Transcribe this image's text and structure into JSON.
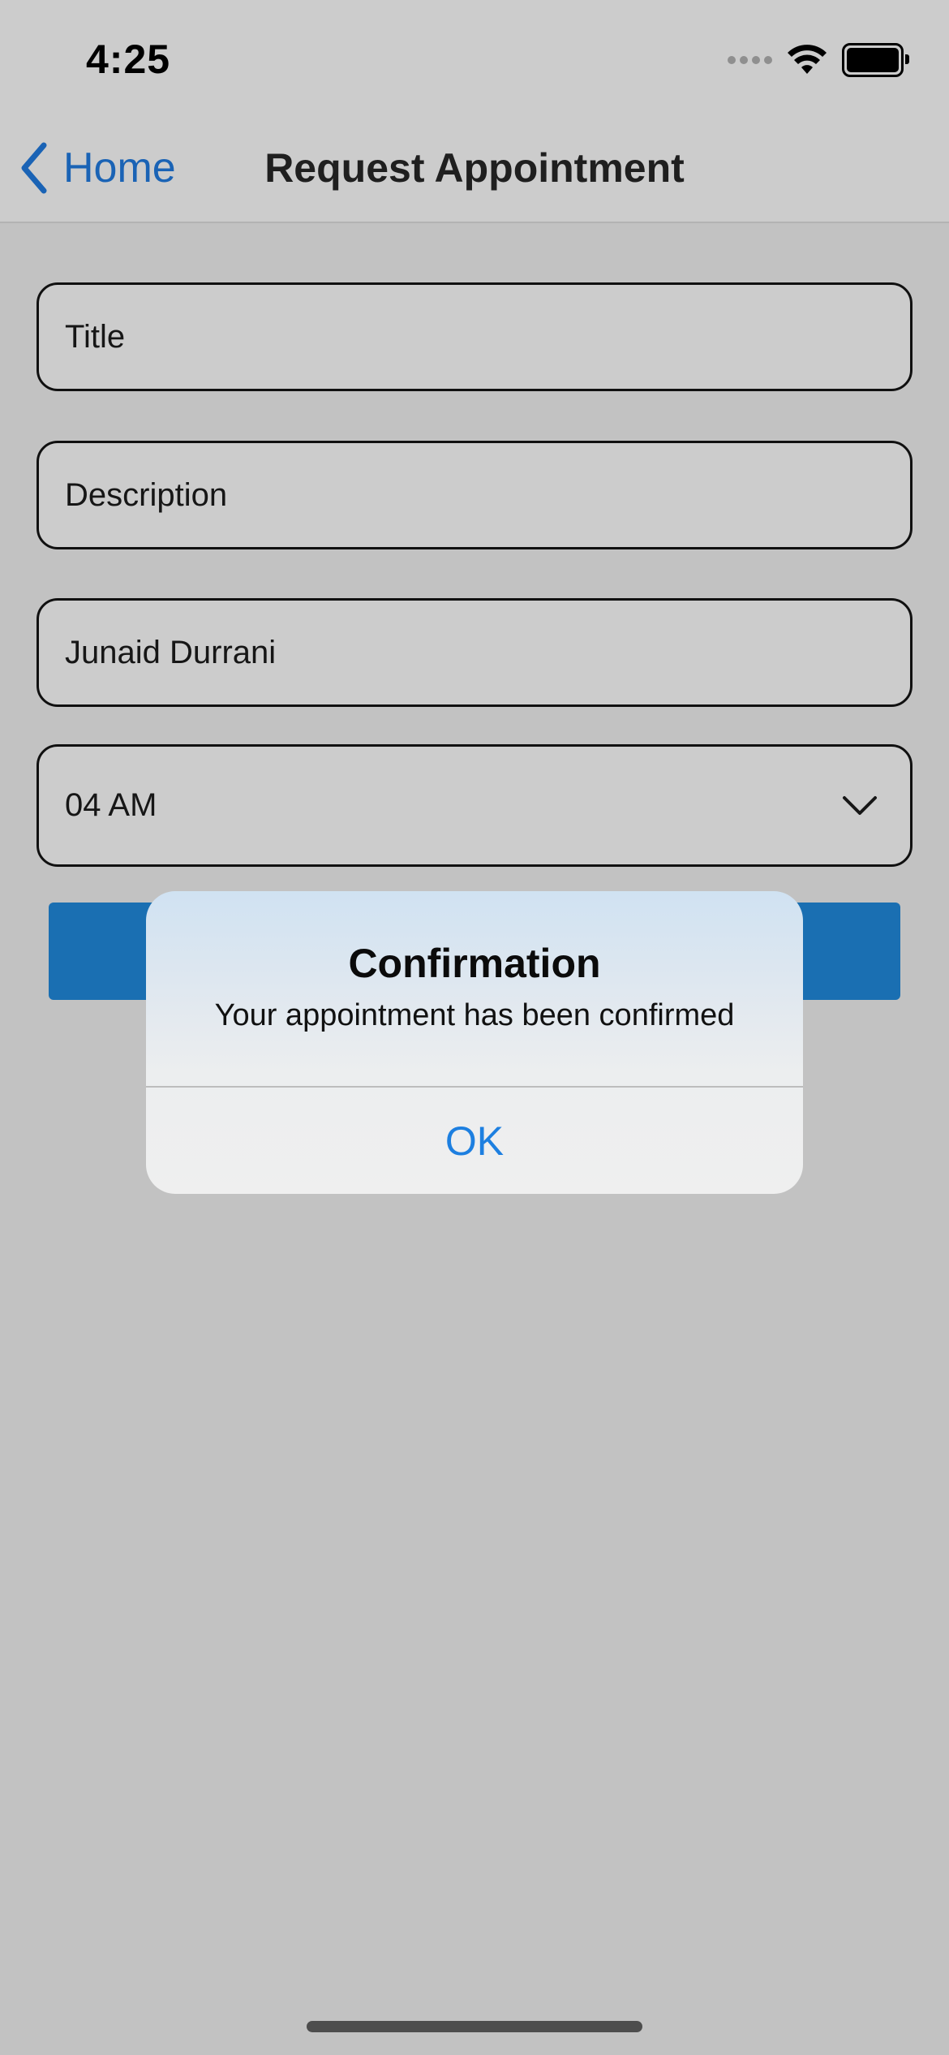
{
  "status_bar": {
    "time": "4:25",
    "icons": [
      "cellular-signal-icon",
      "wifi-icon",
      "battery-icon"
    ]
  },
  "nav": {
    "back_label": "Home",
    "title": "Request Appointment"
  },
  "form": {
    "title_placeholder": "Title",
    "description_placeholder": "Description",
    "name_value": "Junaid Durrani",
    "time_value": "04 AM"
  },
  "alert": {
    "title": "Confirmation",
    "message": "Your appointment has been confirmed",
    "ok_label": "OK"
  },
  "colors": {
    "accent": "#1a63b5",
    "submit_button": "#1a6fb2",
    "alert_button_text": "#1d7fe0",
    "dim_background": "#c2c2c2"
  }
}
